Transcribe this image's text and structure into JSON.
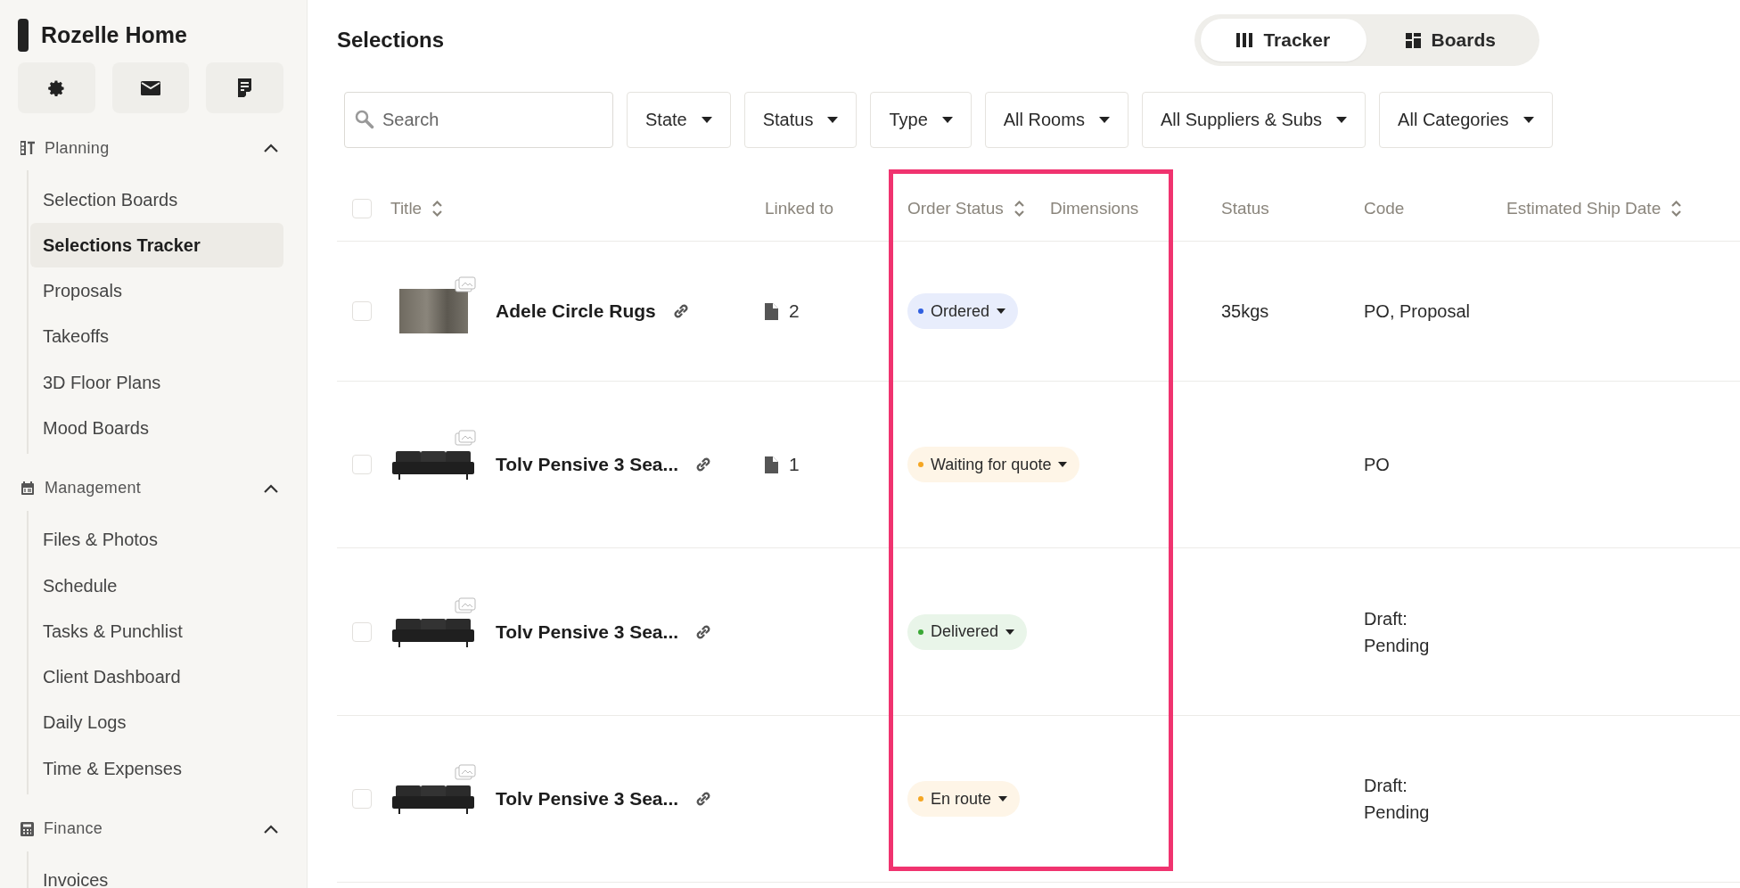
{
  "sidebar": {
    "title": "Rozelle Home",
    "sections": [
      {
        "label": "Planning",
        "expanded": true,
        "items": [
          {
            "label": "Selection Boards",
            "selected": false
          },
          {
            "label": "Selections Tracker",
            "selected": true
          },
          {
            "label": "Proposals",
            "selected": false
          },
          {
            "label": "Takeoffs",
            "selected": false
          },
          {
            "label": "3D Floor Plans",
            "selected": false
          },
          {
            "label": "Mood Boards",
            "selected": false
          }
        ]
      },
      {
        "label": "Management",
        "expanded": true,
        "items": [
          {
            "label": "Files & Photos",
            "selected": false
          },
          {
            "label": "Schedule",
            "selected": false
          },
          {
            "label": "Tasks & Punchlist",
            "selected": false
          },
          {
            "label": "Client Dashboard",
            "selected": false
          },
          {
            "label": "Daily Logs",
            "selected": false
          },
          {
            "label": "Time & Expenses",
            "selected": false
          }
        ]
      },
      {
        "label": "Finance",
        "expanded": true,
        "items": [
          {
            "label": "Invoices",
            "selected": false
          }
        ]
      }
    ]
  },
  "page_title": "Selections",
  "view_toggle": [
    {
      "label": "Tracker",
      "selected": true
    },
    {
      "label": "Boards",
      "selected": false
    }
  ],
  "search": {
    "placeholder": "Search"
  },
  "filters": [
    "State",
    "Status",
    "Type",
    "All Rooms",
    "All Suppliers & Subs",
    "All Categories"
  ],
  "table": {
    "select_all": {
      "checked": false
    },
    "columns": [
      {
        "label": "Title",
        "sortable": true,
        "highlighted": false
      },
      {
        "label": "Linked to",
        "sortable": false,
        "highlighted": false
      },
      {
        "label": "Order Status",
        "sortable": true,
        "highlighted": true
      },
      {
        "label": "Dimensions",
        "sortable": false,
        "highlighted": true
      },
      {
        "label": "Status",
        "sortable": false,
        "highlighted": false
      },
      {
        "label": "Code",
        "sortable": false,
        "highlighted": false
      },
      {
        "label": "Estimated Ship Date",
        "sortable": true,
        "highlighted": false
      }
    ],
    "rows": [
      {
        "checked": false,
        "kind": "rug",
        "title": "Adele Circle Rugs",
        "linked_files": "2",
        "order_status": {
          "label": "Ordered",
          "color": "#2f5fe0"
        },
        "status": "35kgs",
        "code": "PO, Proposal"
      },
      {
        "checked": false,
        "kind": "sofa",
        "title": "Tolv Pensive 3 Sea...",
        "linked_files": "1",
        "order_status": {
          "label": "Waiting for quote",
          "color": "#f5a623"
        },
        "code": "PO"
      },
      {
        "checked": false,
        "kind": "sofa",
        "title": "Tolv Pensive 3 Sea...",
        "order_status": {
          "label": "Delivered",
          "color": "#3aa835"
        },
        "code": "Draft:\nPending"
      },
      {
        "checked": false,
        "kind": "sofa",
        "title": "Tolv Pensive 3 Sea...",
        "order_status": {
          "label": "En route",
          "color": "#f5a623"
        },
        "code": "Draft:\nPending"
      }
    ]
  }
}
